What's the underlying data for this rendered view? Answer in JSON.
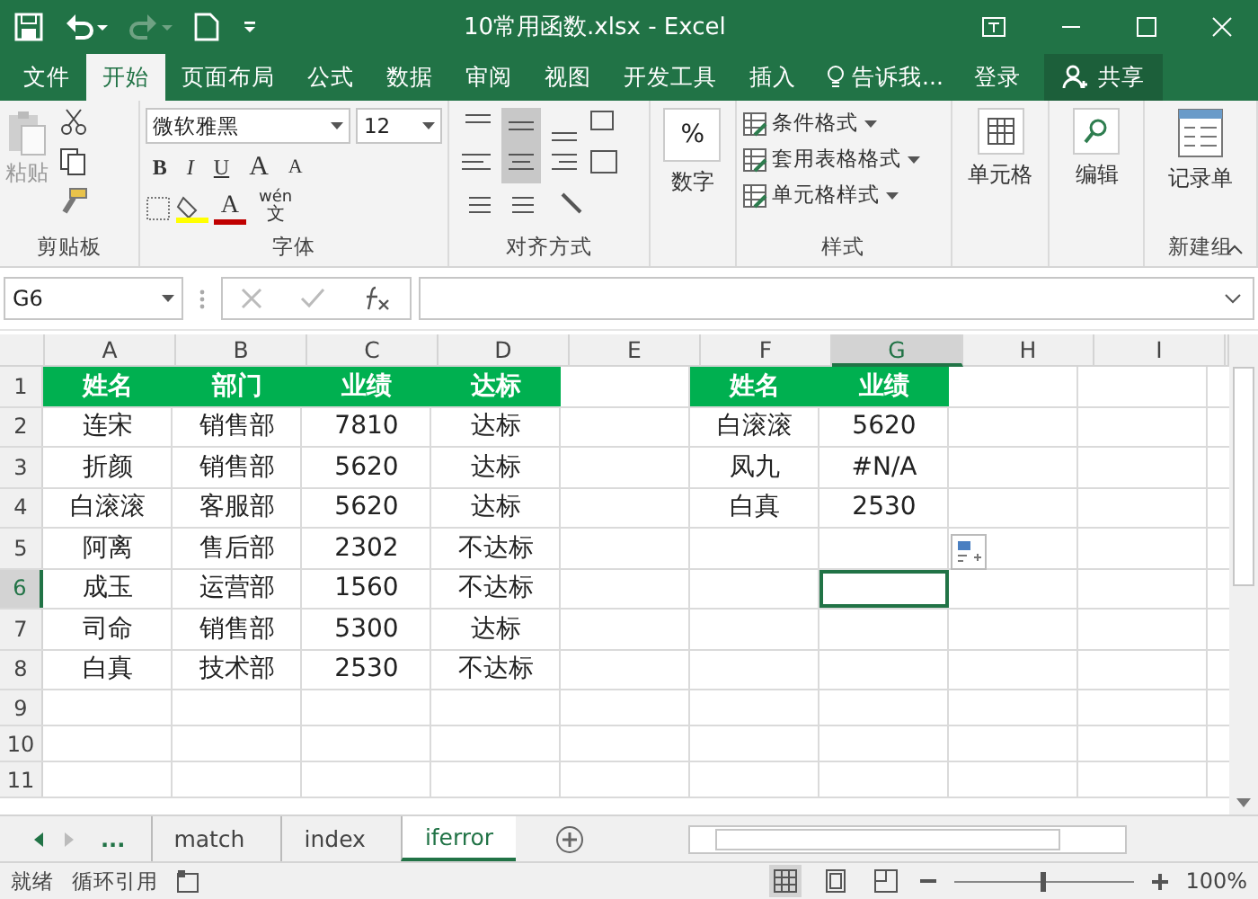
{
  "window": {
    "title": "10常用函数.xlsx - Excel"
  },
  "tabs": [
    {
      "label": "文件",
      "selected": false
    },
    {
      "label": "开始",
      "selected": true
    },
    {
      "label": "页面布局",
      "selected": false
    },
    {
      "label": "公式",
      "selected": false
    },
    {
      "label": "数据",
      "selected": false
    },
    {
      "label": "审阅",
      "selected": false
    },
    {
      "label": "视图",
      "selected": false
    },
    {
      "label": "开发工具",
      "selected": false
    },
    {
      "label": "插入",
      "selected": false
    }
  ],
  "tell_me": "告诉我...",
  "sign_in": "登录",
  "share": "共享",
  "ribbon": {
    "clipboard": {
      "paste": "粘贴",
      "label": "剪贴板"
    },
    "font": {
      "font_name": "微软雅黑",
      "font_size": "12",
      "format_buttons": [
        "B",
        "I",
        "U"
      ],
      "size_buttons": [
        "A",
        "A"
      ],
      "font_color": "A",
      "phonetic": [
        "wén",
        "文"
      ],
      "label": "字体"
    },
    "alignment": {
      "label": "对齐方式"
    },
    "number": {
      "symbol": "%",
      "button": "数字"
    },
    "styles": {
      "items": [
        "条件格式",
        "套用表格格式",
        "单元格样式"
      ],
      "label": "样式"
    },
    "cells": {
      "button": "单元格"
    },
    "editing": {
      "button": "编辑"
    },
    "new_group": {
      "button": "记录单",
      "label": "新建组"
    }
  },
  "name_box": "G6",
  "sheet": {
    "columns": [
      {
        "label": "A",
        "selected": false
      },
      {
        "label": "B",
        "selected": false
      },
      {
        "label": "C",
        "selected": false
      },
      {
        "label": "D",
        "selected": false
      },
      {
        "label": "E",
        "selected": false
      },
      {
        "label": "F",
        "selected": false
      },
      {
        "label": "G",
        "selected": true
      },
      {
        "label": "H",
        "selected": false
      },
      {
        "label": "I",
        "selected": false
      }
    ],
    "header_row": {
      "number": "1",
      "selected": false,
      "cells": [
        "姓名",
        "部门",
        "业绩",
        "达标",
        null,
        "姓名",
        "业绩"
      ]
    },
    "rows": [
      {
        "number": "2",
        "selected": false,
        "cells": [
          "连宋",
          "销售部",
          "7810",
          "达标",
          null,
          "白滚滚",
          "5620"
        ]
      },
      {
        "number": "3",
        "selected": false,
        "cells": [
          "折颜",
          "销售部",
          "5620",
          "达标",
          null,
          "凤九",
          "#N/A"
        ]
      },
      {
        "number": "4",
        "selected": false,
        "cells": [
          "白滚滚",
          "客服部",
          "5620",
          "达标",
          null,
          "白真",
          "2530"
        ]
      },
      {
        "number": "5",
        "selected": false,
        "cells": [
          "阿离",
          "售后部",
          "2302",
          "不达标"
        ]
      },
      {
        "number": "6",
        "selected": true,
        "cells": [
          "成玉",
          "运营部",
          "1560",
          "不达标"
        ]
      },
      {
        "number": "7",
        "selected": false,
        "cells": [
          "司命",
          "销售部",
          "5300",
          "达标"
        ]
      },
      {
        "number": "8",
        "selected": false,
        "cells": [
          "白真",
          "技术部",
          "2530",
          "不达标"
        ]
      },
      {
        "number": "9",
        "selected": false,
        "cells": []
      },
      {
        "number": "10",
        "selected": false,
        "cells": []
      },
      {
        "number": "11",
        "selected": false,
        "cells": []
      }
    ]
  },
  "sheet_tabs": {
    "more": "...",
    "tabs": [
      {
        "label": "match",
        "selected": false
      },
      {
        "label": "index",
        "selected": false
      },
      {
        "label": "iferror",
        "selected": true
      }
    ]
  },
  "status_bar": {
    "items": [
      "就绪",
      "循环引用"
    ],
    "zoom": {
      "level": 0.5,
      "reading": "100%"
    }
  }
}
